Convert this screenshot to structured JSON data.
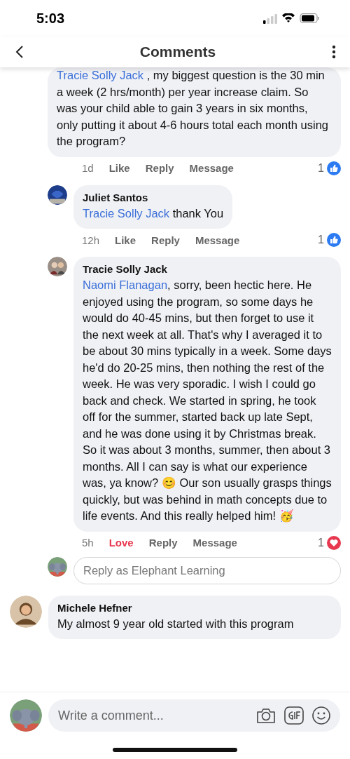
{
  "status_bar": {
    "time": "5:03"
  },
  "header": {
    "title": "Comments"
  },
  "comments": [
    {
      "kind": "reply",
      "mention": "Tracie Solly Jack",
      "text": " , my biggest question is the 30 min a week (2 hrs/month) per year increase claim. So was your child able to gain 3 years in six months, only putting it about 4-6 hours total each month using the program?",
      "time": "1d",
      "reaction_label": "Like",
      "reacted": false,
      "reply_label": "Reply",
      "message_label": "Message",
      "reaction": {
        "kind": "like",
        "count": "1"
      }
    },
    {
      "kind": "reply",
      "author": "Juliet Santos",
      "mention": "Tracie Solly Jack",
      "text": " thank You",
      "time": "12h",
      "reaction_label": "Like",
      "reacted": false,
      "reply_label": "Reply",
      "message_label": "Message",
      "reaction": {
        "kind": "like",
        "count": "1"
      }
    },
    {
      "kind": "reply",
      "author": "Tracie Solly Jack",
      "mention": "Naomi Flanagan",
      "text": ", sorry, been hectic here. He enjoyed using the program, so some days he would do 40-45 mins, but then forget to use it the next week at all. That's why I averaged it to be about 30 mins typically in a week. Some days he'd do 20-25 mins, then nothing the rest of the week. He was very sporadic. I wish I could go back and check. We started in spring, he took off for the summer, started back up late Sept, and he was done using it by Christmas break. So it was about 3 months, summer, then about 3 months. All I can say is what our experience was, ya know? 😊 Our son usually grasps things quickly, but was behind in math concepts due to life events. And this really helped him! 🥳",
      "time": "5h",
      "reaction_label": "Love",
      "reacted": true,
      "reply_label": "Reply",
      "message_label": "Message",
      "reaction": {
        "kind": "love",
        "count": "1"
      }
    },
    {
      "kind": "reply_box",
      "placeholder": "Reply as Elephant Learning"
    },
    {
      "kind": "comment",
      "author": "Michele Hefner",
      "text": "My almost 9 year old started with this program"
    }
  ],
  "composer": {
    "placeholder": "Write a comment..."
  }
}
